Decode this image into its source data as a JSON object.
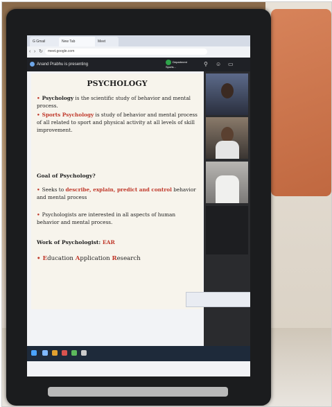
{
  "browser": {
    "tabs": [
      "G Gmail",
      "New Tab",
      "Meet"
    ],
    "url": "meet.google.com"
  },
  "meet": {
    "presenting_text": "Anand Prabhu is presenting",
    "badge_text": "Department Sports..."
  },
  "slide": {
    "title": "PSYCHOLOGY",
    "p1_a": "Psychology",
    "p1_b": " is the scientific study of behavior and mental process.",
    "p2_a": "Sports Psychology",
    "p2_b": " is study of behavior and mental process of all related to sport and physical activity at all levels of skill improvement.",
    "goal_heading": "Goal of Psychology?",
    "g1_a": "Seeks to ",
    "g1_b": "describe, explain, predict and control",
    "g1_c": " behavior and mental process",
    "g2": "Psychologists are interested in all aspects of human behavior and mental process.",
    "work_a": "Work of Psychologist: ",
    "work_b": "EAR",
    "ear_E": "E",
    "ear_ducation": "ducation ",
    "ear_A": "A",
    "ear_pplication": "pplication ",
    "ear_R": "R",
    "ear_esearch": "esearch"
  },
  "colors": {
    "accent_red": "#c0392b",
    "meet_bar": "#1f2126"
  },
  "icons": [
    "back-icon",
    "forward-icon",
    "reload-icon",
    "pin-icon",
    "people-icon",
    "chat-icon",
    "windows-start-icon"
  ]
}
